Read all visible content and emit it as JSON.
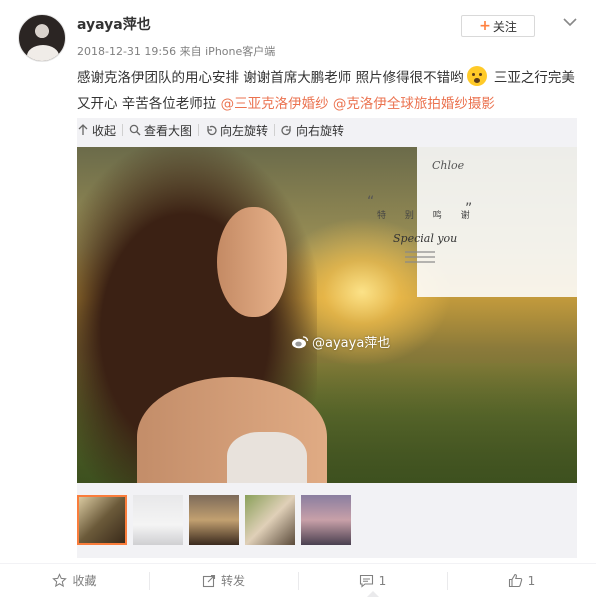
{
  "post": {
    "username": "ayaya萍也",
    "timestamp": "2018-12-31 19:56",
    "source_prefix": "来自",
    "source": "iPhone客户端",
    "follow_label": "关注",
    "text_part1": "感谢克洛伊团队的用心安排  谢谢首席大鹏老师 照片修得很不错哟",
    "text_part2": " 三亚之行完美又开心 辛苦各位老师拉 ",
    "link1": "@三亚克洛伊婚纱",
    "link2": "@克洛伊全球旅拍婚纱摄影"
  },
  "image_toolbar": {
    "collapse": "收起",
    "view_large": "查看大图",
    "rotate_left": "向左旋转",
    "rotate_right": "向右旋转"
  },
  "photo_overlay": {
    "brand": "Chloe",
    "title": "特 别 鸣 谢",
    "subtitle": "Special you",
    "watermark": "@ayaya萍也"
  },
  "thumbnails": [
    {
      "name": "thumb-1"
    },
    {
      "name": "thumb-2"
    },
    {
      "name": "thumb-3"
    },
    {
      "name": "thumb-4"
    },
    {
      "name": "thumb-5"
    }
  ],
  "actions": {
    "favorite": "收藏",
    "repost": "转发",
    "comment": "1",
    "like": "1"
  },
  "colors": {
    "accent_orange": "#fa7d3c",
    "link_color": "#eb7350"
  }
}
